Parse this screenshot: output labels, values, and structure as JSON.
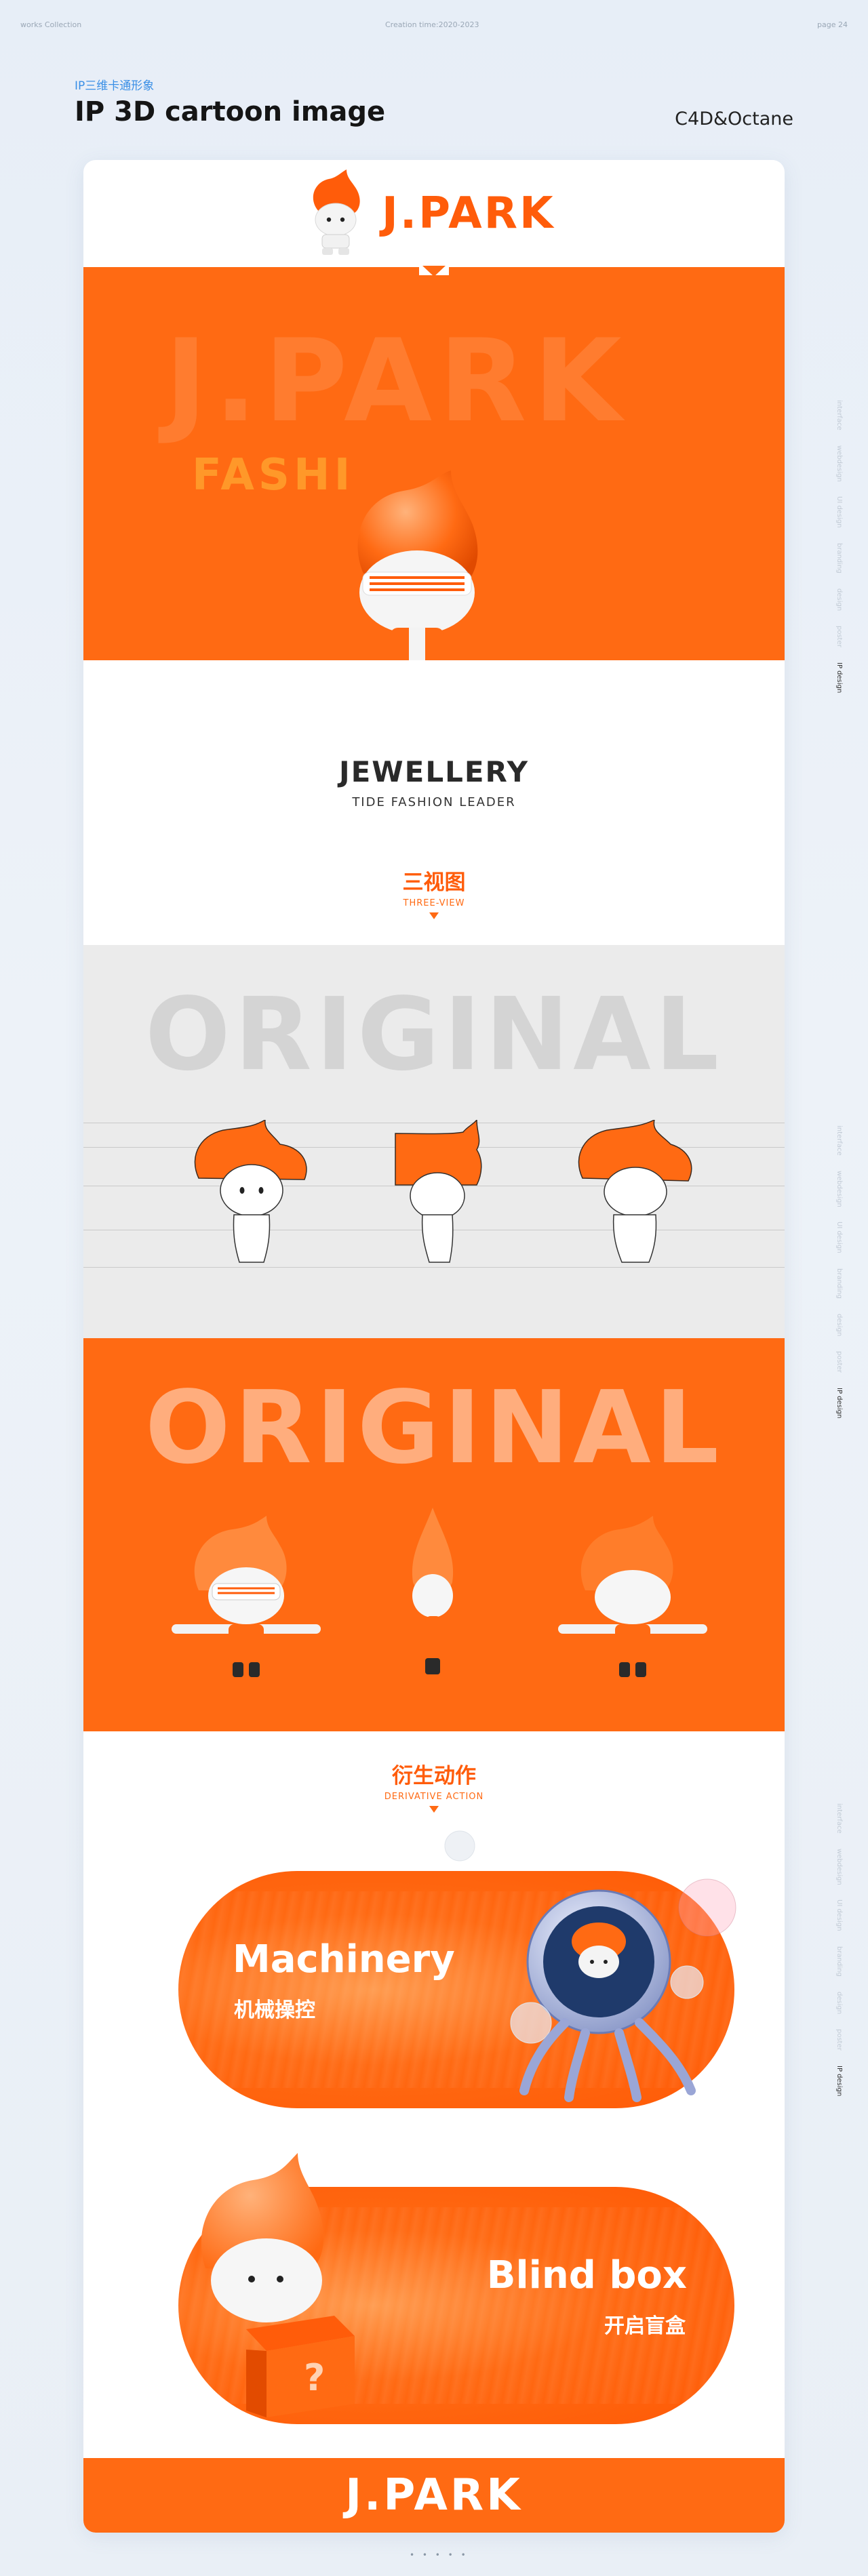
{
  "topbar": {
    "left": "works Collection",
    "center": "Creation time:2020-2023",
    "right": "page 24"
  },
  "header": {
    "subtitle": "IP三维卡通形象",
    "title": "IP 3D cartoon image",
    "tools": "C4D&Octane"
  },
  "card": {
    "logo_text": "J.PARK",
    "hero_bg_text": "J.PARK",
    "hero_fashion_text": "FASHI",
    "product_title": "JEWELLERY",
    "product_tagline": "TIDE  FASHION LEADER",
    "three_view": {
      "cn": "三视图",
      "en": "THREE-VIEW"
    },
    "original_grey": "ORIGINAL",
    "original_orange": "ORIGINAL",
    "derivative": {
      "cn": "衍生动作",
      "en": "DERIVATIVE ACTION"
    },
    "machinery": {
      "title": "Machinery",
      "cn": "机械操控"
    },
    "blind_box": {
      "title": "Blind box",
      "cn": "开启盲盒"
    },
    "footer_logo": "J.PARK"
  },
  "sidebar": {
    "items": [
      "interface",
      "webdesign",
      "UI design",
      "branding",
      "design",
      "poster",
      "IP design"
    ]
  },
  "pager": "• • • • •",
  "colors": {
    "accent": "#ff6a13",
    "blue": "#3a8fe6",
    "grey_panel": "#ebebeb"
  }
}
